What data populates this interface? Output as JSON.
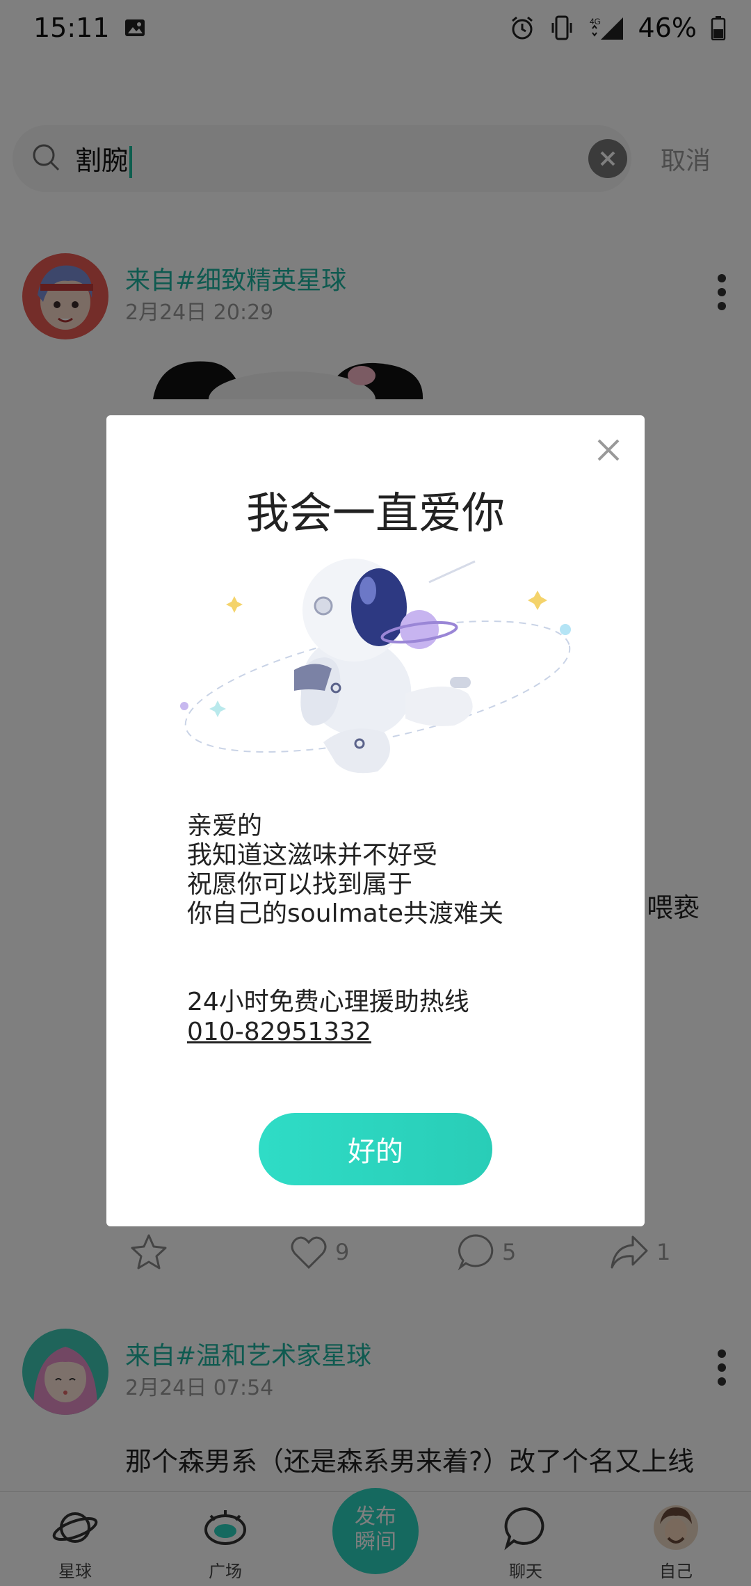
{
  "status_bar": {
    "time": "15:11",
    "network": "4G",
    "battery": "46%",
    "icons": [
      "image-icon",
      "alarm-icon",
      "vibrate-icon",
      "signal-icon",
      "battery-icon"
    ]
  },
  "search": {
    "query": "割腕",
    "cancel_label": "取消"
  },
  "posts": [
    {
      "from": "来自#细致精英星球",
      "time": "2月24日 20:29",
      "partial_text": "喂亵",
      "stats": {
        "likes": "9",
        "comments": "5",
        "shares": "1"
      }
    },
    {
      "from": "来自#温和艺术家星球",
      "time": "2月24日 07:54",
      "text": "那个森男系（还是森系男来着?）改了个名又上线"
    }
  ],
  "bottom_nav": {
    "items": [
      {
        "label": "星球",
        "icon": "planet-icon"
      },
      {
        "label": "广场",
        "icon": "eye-icon"
      },
      {
        "label": "聊天",
        "icon": "chat-icon"
      },
      {
        "label": "自己",
        "icon": "avatar-icon"
      }
    ],
    "publish_line1": "发布",
    "publish_line2": "瞬间"
  },
  "dialog": {
    "title": "我会一直爱你",
    "message_lines": [
      "亲爱的",
      "我知道这滋味并不好受",
      "祝愿你可以找到属于",
      "你自己的soulmate共渡难关"
    ],
    "hotline_label": "24小时免费心理援助热线",
    "hotline_number": "010-82951332",
    "ok_label": "好的"
  },
  "colors": {
    "accent": "#2bd3be",
    "link_green": "#1fb5a0",
    "overlay": "rgba(0,0,0,0.5)"
  }
}
